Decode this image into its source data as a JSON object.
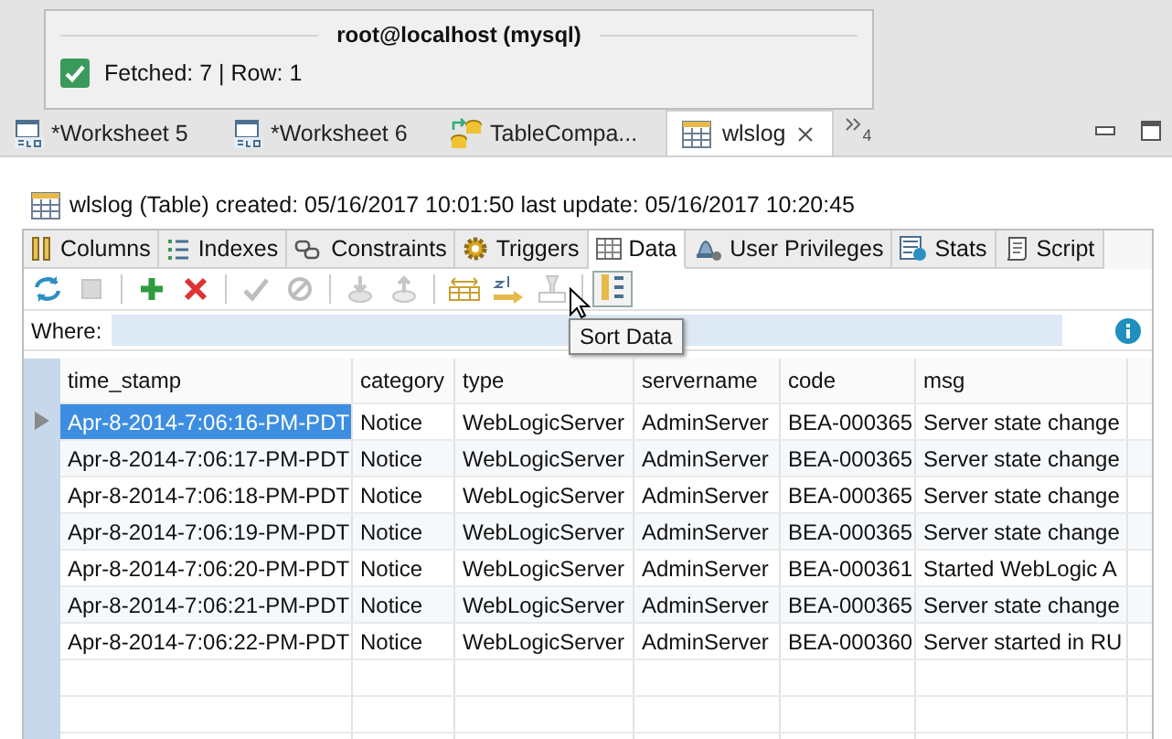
{
  "connection_popup": {
    "title": "root@localhost (mysql)",
    "status": "Fetched: 7 | Row: 1",
    "success": true
  },
  "editor_tabs": [
    {
      "label": "*Worksheet 5",
      "kind": "worksheet",
      "selected": false
    },
    {
      "label": "*Worksheet 6",
      "kind": "worksheet",
      "selected": false
    },
    {
      "label": "TableCompa...",
      "kind": "compare",
      "selected": false
    },
    {
      "label": "wlslog",
      "kind": "table",
      "selected": true
    }
  ],
  "overflow_count": "4",
  "table_info": "wlslog (Table) created: 05/16/2017 10:01:50 last update: 05/16/2017 10:20:45",
  "sub_tabs": [
    {
      "label": "Columns",
      "kind": "columns",
      "selected": false
    },
    {
      "label": "Indexes",
      "kind": "indexes",
      "selected": false
    },
    {
      "label": "Constraints",
      "kind": "constraints",
      "selected": false
    },
    {
      "label": "Triggers",
      "kind": "triggers",
      "selected": false
    },
    {
      "label": "Data",
      "kind": "data",
      "selected": true
    },
    {
      "label": "User Privileges",
      "kind": "privileges",
      "selected": false
    },
    {
      "label": "Stats",
      "kind": "stats",
      "selected": false
    },
    {
      "label": "Script",
      "kind": "script",
      "selected": false
    }
  ],
  "toolbar": [
    {
      "kind": "refresh",
      "disabled": false,
      "pressed": false
    },
    {
      "kind": "stop",
      "disabled": true,
      "pressed": false
    },
    {
      "kind": "add",
      "disabled": false,
      "pressed": false
    },
    {
      "kind": "delete",
      "disabled": false,
      "pressed": false
    },
    {
      "kind": "commit",
      "disabled": true,
      "pressed": false
    },
    {
      "kind": "cancel",
      "disabled": true,
      "pressed": false
    },
    {
      "kind": "import",
      "disabled": true,
      "pressed": false
    },
    {
      "kind": "export",
      "disabled": true,
      "pressed": false
    },
    {
      "kind": "fit",
      "disabled": false,
      "pressed": false
    },
    {
      "kind": "sort",
      "disabled": false,
      "pressed": false
    },
    {
      "kind": "filter",
      "disabled": true,
      "pressed": false
    },
    {
      "kind": "sortdata",
      "disabled": false,
      "pressed": true
    }
  ],
  "tooltip": "Sort Data",
  "where": {
    "label": "Where:"
  },
  "table": {
    "columns": [
      "time_stamp",
      "category",
      "type",
      "servername",
      "code",
      "msg"
    ],
    "rows": [
      {
        "selected": true,
        "cells": [
          "Apr-8-2014-7:06:16-PM-PDT",
          "Notice",
          "WebLogicServer",
          "AdminServer",
          "BEA-000365",
          "Server state change"
        ]
      },
      {
        "selected": false,
        "cells": [
          "Apr-8-2014-7:06:17-PM-PDT",
          "Notice",
          "WebLogicServer",
          "AdminServer",
          "BEA-000365",
          "Server state change"
        ]
      },
      {
        "selected": false,
        "cells": [
          "Apr-8-2014-7:06:18-PM-PDT",
          "Notice",
          "WebLogicServer",
          "AdminServer",
          "BEA-000365",
          "Server state change"
        ]
      },
      {
        "selected": false,
        "cells": [
          "Apr-8-2014-7:06:19-PM-PDT",
          "Notice",
          "WebLogicServer",
          "AdminServer",
          "BEA-000365",
          "Server state change"
        ]
      },
      {
        "selected": false,
        "cells": [
          "Apr-8-2014-7:06:20-PM-PDT",
          "Notice",
          "WebLogicServer",
          "AdminServer",
          "BEA-000361",
          "Started WebLogic A"
        ]
      },
      {
        "selected": false,
        "cells": [
          "Apr-8-2014-7:06:21-PM-PDT",
          "Notice",
          "WebLogicServer",
          "AdminServer",
          "BEA-000365",
          "Server state change"
        ]
      },
      {
        "selected": false,
        "cells": [
          "Apr-8-2014-7:06:22-PM-PDT",
          "Notice",
          "WebLogicServer",
          "AdminServer",
          "BEA-000360",
          "Server started in RU"
        ]
      }
    ]
  }
}
